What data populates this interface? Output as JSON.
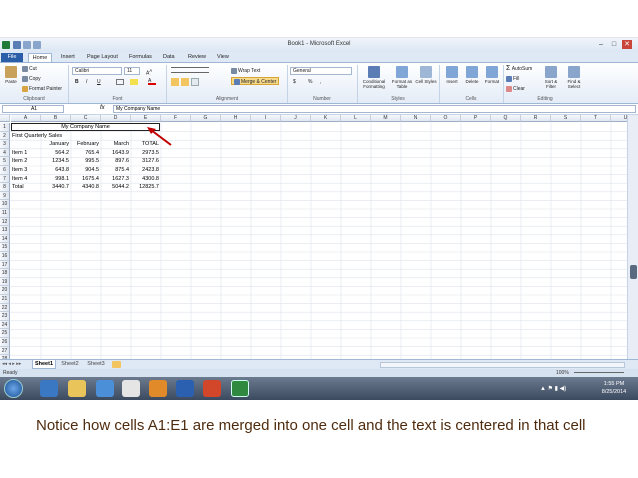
{
  "window": {
    "title": "Book1 - Microsoft Excel",
    "controls": [
      "–",
      "□",
      "✕"
    ]
  },
  "ribbon_tabs": [
    "File",
    "Home",
    "Insert",
    "Page Layout",
    "Formulas",
    "Data",
    "Review",
    "View"
  ],
  "clipboard": {
    "cut": "Cut",
    "copy": "Copy",
    "paste": "Paste",
    "format_painter": "Format Painter",
    "group": "Clipboard"
  },
  "font": {
    "name": "Calibri",
    "size": "11",
    "bold": "B",
    "italic": "I",
    "underline": "U",
    "group": "Font"
  },
  "alignment": {
    "wrap": "Wrap Text",
    "merge": "Merge & Center",
    "group": "Alignment"
  },
  "number": {
    "format": "General",
    "currency": "$",
    "percent": "%",
    "comma": ",",
    "group": "Number"
  },
  "styles": {
    "conditional": "Conditional Formatting",
    "format_table": "Format as Table",
    "cell_styles": "Cell Styles",
    "group": "Styles"
  },
  "cells": {
    "insert": "Insert",
    "delete": "Delete",
    "format": "Format",
    "group": "Cells"
  },
  "editing": {
    "autosum": "AutoSum",
    "fill": "Fill",
    "clear": "Clear",
    "sort": "Sort & Filter",
    "find": "Find & Select",
    "group": "Editing"
  },
  "formula_bar": {
    "name_box": "A1",
    "fx": "fx",
    "content": "My Company Name"
  },
  "columns": [
    "A",
    "B",
    "C",
    "D",
    "E",
    "F",
    "G",
    "H",
    "I",
    "J",
    "K",
    "L",
    "M",
    "N",
    "O",
    "P",
    "Q",
    "R",
    "S",
    "T",
    "U"
  ],
  "row_numbers": [
    "1",
    "2",
    "3",
    "4",
    "5",
    "6",
    "7",
    "8",
    "9",
    "10",
    "11",
    "12",
    "13",
    "14",
    "15",
    "16",
    "17",
    "18",
    "19",
    "20",
    "21",
    "22",
    "23",
    "24",
    "25",
    "26",
    "27",
    "28"
  ],
  "cells_data": {
    "merged_title": "My Company Name",
    "subtitle": "First Quarterly Sales",
    "headers": [
      "January",
      "February",
      "March",
      "TOTAL"
    ],
    "rows": [
      {
        "label": "Item 1",
        "values": [
          "564.2",
          "765.4",
          "1643.9",
          "2973.5"
        ]
      },
      {
        "label": "Item 2",
        "values": [
          "1234.5",
          "995.5",
          "897.6",
          "3127.6"
        ]
      },
      {
        "label": "Item 3",
        "values": [
          "643.8",
          "904.5",
          "875.4",
          "2423.8"
        ]
      },
      {
        "label": "Item 4",
        "values": [
          "998.1",
          "1675.4",
          "1627.3",
          "4300.8"
        ]
      },
      {
        "label": "Total",
        "values": [
          "3440.7",
          "4340.8",
          "5044.2",
          "12825.7"
        ]
      }
    ]
  },
  "sheet_tabs": [
    "Sheet1",
    "Sheet2",
    "Sheet3"
  ],
  "status": {
    "ready": "Ready",
    "zoom": "100%"
  },
  "taskbar": {
    "time": "1:55 PM",
    "date": "8/25/2014"
  },
  "caption": "Notice how cells A1:E1 are merged into one cell and the text is centered in that cell",
  "colors": {
    "accent": "#2a5ea8",
    "arrow": "#c00000",
    "caption": "#4f2b0e"
  }
}
